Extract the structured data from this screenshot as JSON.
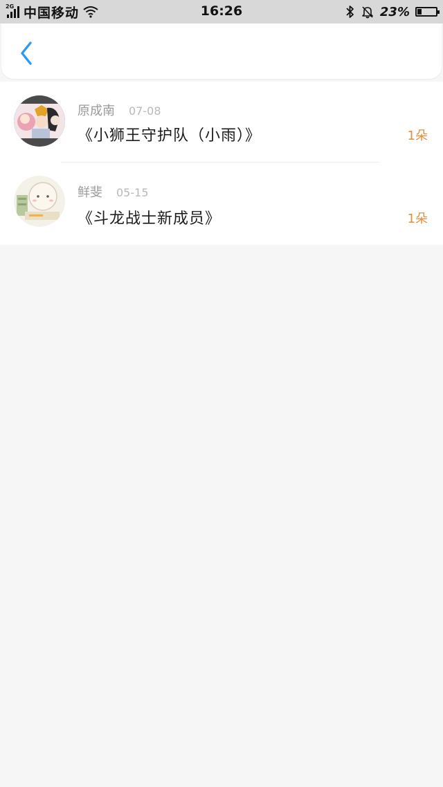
{
  "status_bar": {
    "network": "2G",
    "carrier": "中国移动",
    "time": "16:26",
    "battery": "23%",
    "battery_level": 0.23
  },
  "nav": {
    "back_icon": "chevron-left-icon",
    "accent_color": "#2b9af3"
  },
  "items": [
    {
      "name": "原成南",
      "date": "07-08",
      "title": "《小狮王守护队（小雨）》",
      "count": "1朵"
    },
    {
      "name": "鲜斐",
      "date": "05-15",
      "title": "《斗龙战士新成员》",
      "count": "1朵"
    }
  ],
  "colors": {
    "count": "#e58c3b",
    "background": "#f6f6f6"
  }
}
